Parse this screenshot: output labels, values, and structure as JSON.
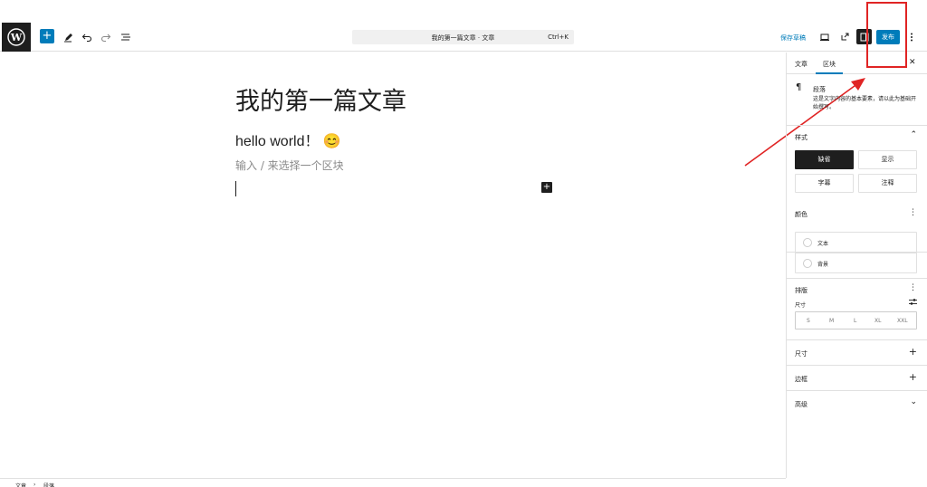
{
  "topbar": {
    "command_title": "我的第一篇文章 · 文章",
    "command_shortcut": "Ctrl+K",
    "save_draft": "保存草稿",
    "publish": "发布"
  },
  "editor": {
    "title": "我的第一篇文章",
    "paragraph": "hello world！ 😊",
    "placeholder": "输入 / 来选择一个区块"
  },
  "sidebar": {
    "tabs": [
      "文章",
      "区块"
    ],
    "block": {
      "icon": "¶",
      "name": "段落",
      "description": "这是文字内容的基本要素，请以此为基础开始撰写。"
    },
    "style": {
      "title": "样式",
      "options": [
        "缺省",
        "显示",
        "字幕",
        "注释"
      ]
    },
    "color": {
      "title": "颜色",
      "items": [
        "文本",
        "背景"
      ]
    },
    "typography": {
      "title": "排版",
      "size_label": "尺寸",
      "sizes": [
        "S",
        "M",
        "L",
        "XL",
        "XXL"
      ]
    },
    "dimensions": {
      "title": "尺寸"
    },
    "border": {
      "title": "边框"
    },
    "advanced": {
      "title": "高级"
    }
  },
  "footer": {
    "breadcrumb": [
      "文章",
      "段落"
    ],
    "separator": "›"
  },
  "colors": {
    "accent": "#007cba",
    "dark": "#1e1e1e",
    "annotation": "#e02424"
  }
}
